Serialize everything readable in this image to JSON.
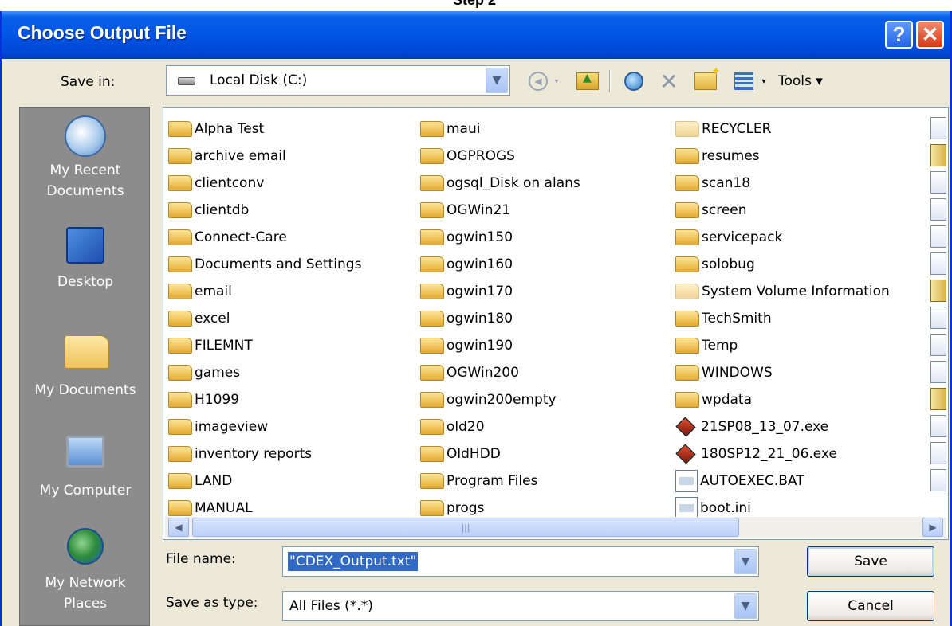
{
  "caption": "Step 2",
  "window": {
    "title": "Choose Output File",
    "help_glyph": "?",
    "close_glyph": "✕"
  },
  "save_in": {
    "label": "Save in:",
    "value": "Local Disk (C:)",
    "arrow": "▼"
  },
  "toolbar": {
    "tools_label": "Tools ▾",
    "delete_glyph": "✕",
    "drop_glyph": "▾",
    "back_glyph": "◀"
  },
  "places": [
    {
      "label": "My Recent Documents",
      "icon": "recent-documents-icon"
    },
    {
      "label": "Desktop",
      "icon": "desktop-icon"
    },
    {
      "label": "My Documents",
      "icon": "my-documents-icon"
    },
    {
      "label": "My Computer",
      "icon": "my-computer-icon"
    },
    {
      "label": "My Network Places",
      "icon": "network-places-icon"
    }
  ],
  "files": {
    "col1": [
      "Alpha Test",
      "archive email",
      "clientconv",
      "clientdb",
      "Connect-Care",
      "Documents and Settings",
      "email",
      "excel",
      "FILEMNT",
      "games",
      "H1099",
      "imageview",
      "inventory reports",
      "LAND",
      "MANUAL"
    ],
    "col2": [
      "maui",
      "OGPROGS",
      "ogsql_Disk on alans",
      "OGWin21",
      "ogwin150",
      "ogwin160",
      "ogwin170",
      "ogwin180",
      "ogwin190",
      "OGWin200",
      "ogwin200empty",
      "old20",
      "OldHDD",
      "Program Files",
      "progs"
    ],
    "col3": [
      "RECYCLER",
      "resumes",
      "scan18",
      "screen",
      "servicepack",
      "solobug",
      "System Volume Information",
      "TechSmith",
      "Temp",
      "WINDOWS",
      "wpdata",
      "21SP08_13_07.exe",
      "180SP12_21_06.exe",
      "AUTOEXEC.BAT",
      "boot.ini"
    ]
  },
  "scroll": {
    "left": "◀",
    "right": "▶",
    "grip": "|||"
  },
  "file_name": {
    "label": "File name:",
    "value": "\"CDEX_Output.txt\"",
    "arrow": "▼"
  },
  "save_as_type": {
    "label": "Save as type:",
    "value": "All Files (*.*)",
    "arrow": "▼"
  },
  "buttons": {
    "save": "Save",
    "cancel": "Cancel"
  }
}
